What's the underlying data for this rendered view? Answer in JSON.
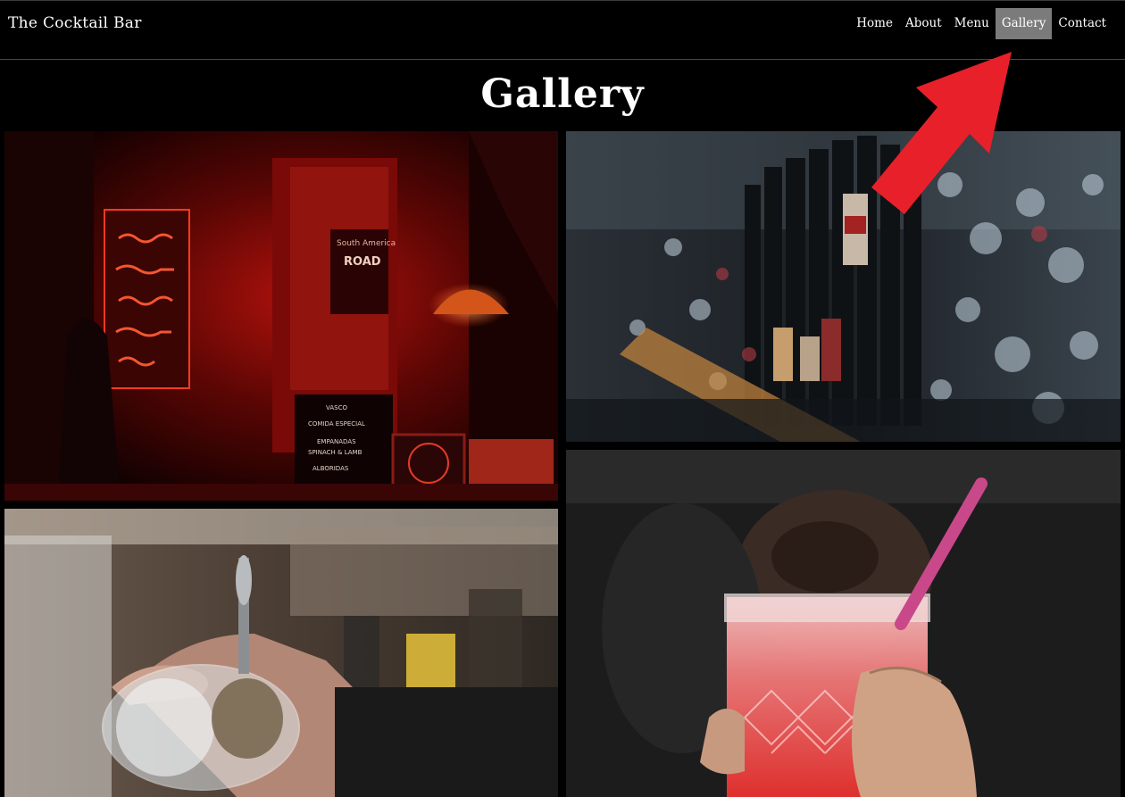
{
  "header": {
    "brand": "The Cocktail Bar",
    "nav": [
      {
        "label": "Home",
        "active": false
      },
      {
        "label": "About",
        "active": false
      },
      {
        "label": "Menu",
        "active": false
      },
      {
        "label": "Gallery",
        "active": true
      },
      {
        "label": "Contact",
        "active": false
      }
    ]
  },
  "main": {
    "title": "Gallery",
    "sign": {
      "line1": "VASCO",
      "line2": "COMIDA ESPECIAL",
      "line3": "EMPANADAS",
      "line4": "SPINACH & LAMB",
      "line5": "ALBORIDAS"
    },
    "poster_text": "South America",
    "poster_text2": "ROAD"
  },
  "colors": {
    "active_tab": "#7b7b7b",
    "neon_red": "#ff2a1a",
    "arrow": "#e8202a"
  }
}
